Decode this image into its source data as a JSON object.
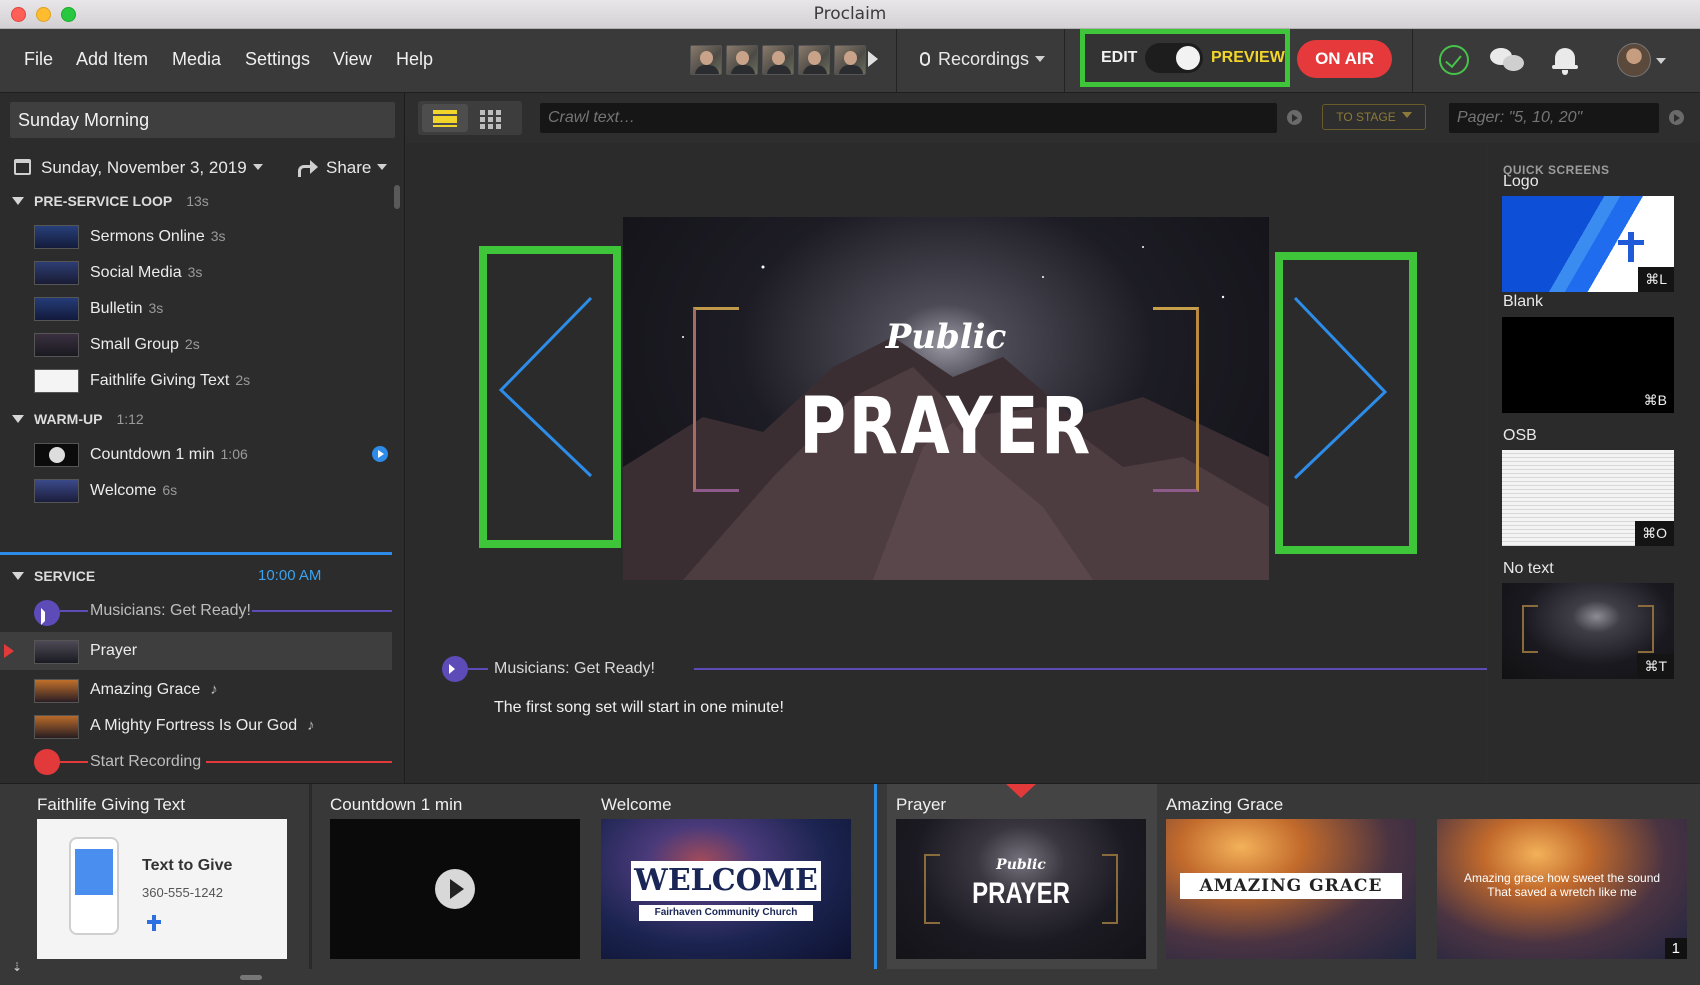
{
  "window": {
    "title": "Proclaim"
  },
  "menu": [
    "File",
    "Add Item",
    "Media",
    "Settings",
    "View",
    "Help"
  ],
  "toolbar": {
    "recordings_label": "Recordings",
    "edit_label": "EDIT",
    "preview_label": "PREVIEW",
    "on_air_label": "ON AIR",
    "accent_green": "#3fc53a",
    "on_air_color": "#e5393b"
  },
  "plan": {
    "title": "Sunday Morning",
    "date": "Sunday, November 3, 2019",
    "share_label": "Share"
  },
  "sections": {
    "preservice": {
      "name": "PRE-SERVICE LOOP",
      "duration": "13s",
      "items": [
        {
          "label": "Sermons Online",
          "duration": "3s"
        },
        {
          "label": "Social Media",
          "duration": "3s"
        },
        {
          "label": "Bulletin",
          "duration": "3s"
        },
        {
          "label": "Small Group",
          "duration": "2s"
        },
        {
          "label": "Faithlife Giving Text",
          "duration": "2s"
        }
      ]
    },
    "warmup": {
      "name": "WARM-UP",
      "duration": "1:12",
      "items": [
        {
          "label": "Countdown 1 min",
          "duration": "1:06"
        },
        {
          "label": "Welcome",
          "duration": "6s"
        }
      ]
    },
    "service": {
      "name": "SERVICE",
      "time": "10:00 AM",
      "items": [
        {
          "label": "Musicians: Get Ready!"
        },
        {
          "label": "Prayer"
        },
        {
          "label": "Amazing Grace"
        },
        {
          "label": "A Mighty Fortress Is Our God"
        },
        {
          "label": "Start Recording"
        }
      ]
    }
  },
  "main": {
    "crawl_placeholder": "Crawl text…",
    "to_stage_label": "TO STAGE",
    "pager_placeholder": "Pager: \"5, 10, 20\"",
    "slide": {
      "subtitle": "Public",
      "title": "PRAYER"
    },
    "cue": {
      "title": "Musicians: Get Ready!",
      "message": "The first song set will start in one minute!"
    }
  },
  "quick_screens": {
    "heading": "QUICK SCREENS",
    "items": [
      {
        "label": "Logo",
        "shortcut": "⌘L"
      },
      {
        "label": "Blank",
        "shortcut": "⌘B"
      },
      {
        "label": "OSB",
        "shortcut": "⌘O"
      },
      {
        "label": "No text",
        "shortcut": "⌘T"
      }
    ]
  },
  "bottom_strip": {
    "cards": [
      {
        "title": "Faithlife Giving Text",
        "text": "Text to Give",
        "phone": "360-555-1242"
      },
      {
        "title": "Countdown 1 min"
      },
      {
        "title": "Welcome",
        "text": "WELCOME",
        "subtext": "Fairhaven Community Church"
      },
      {
        "title": "Prayer",
        "subtext": "Public",
        "text": "PRAYER"
      },
      {
        "title": "Amazing Grace",
        "text": "AMAZING GRACE"
      },
      {
        "title": "",
        "text": "Amazing grace how sweet the sound That saved a wretch like me",
        "badge": "1"
      }
    ]
  }
}
